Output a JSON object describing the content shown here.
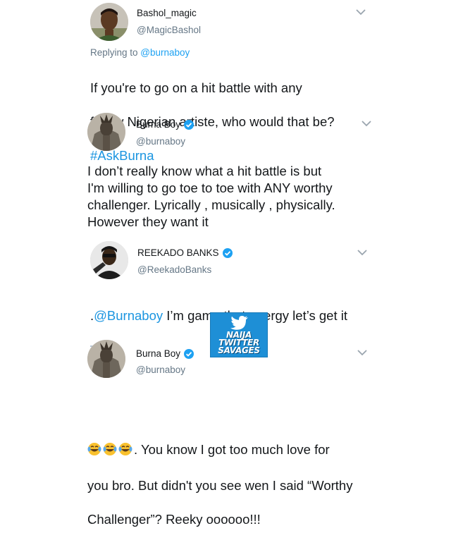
{
  "tweets": [
    {
      "name": "Bashol_magic",
      "handle": "@MagicBashol",
      "verified": false,
      "replying_prefix": "Replying to ",
      "replying_to": "@burnaboy",
      "line1": "If you're to go on a hit battle with any",
      "line2": "fellow Nigerian artiste, who would that be?",
      "hashtag": "#AskBurna"
    },
    {
      "name": "Burna Boy",
      "handle": "@burnaboy",
      "verified": true,
      "text": "I don’t really know what a hit battle is but\nI'm willing to go toe to toe with ANY worthy\nchallenger. Lyrically , musically , physically.\nHowever they want it"
    },
    {
      "name": "REEKADO BANKS",
      "handle": "@ReekadoBanks",
      "verified": true,
      "prefix": ".",
      "mention": "@Burnaboy",
      "text": " I’m game that energy let’s get it",
      "emoji": "dash-emoji"
    },
    {
      "name": "Burna Boy",
      "handle": "@burnaboy",
      "verified": true,
      "emoji": "tears-of-joy-emoji",
      "line1": ". You know I got too much love for",
      "line2": "you bro. But didn't you see wen I said “Worthy",
      "line3": "Challenger”?  Reeky oooooo!!!"
    }
  ],
  "watermark": {
    "line1": "NAIJA",
    "line2": "TWITTER",
    "line3": "SAVAGES"
  },
  "colors": {
    "link": "#1da1f2",
    "hashtag": "#1b95e0",
    "secondary": "#657786",
    "watermark_bg": "#1e8fd6"
  }
}
